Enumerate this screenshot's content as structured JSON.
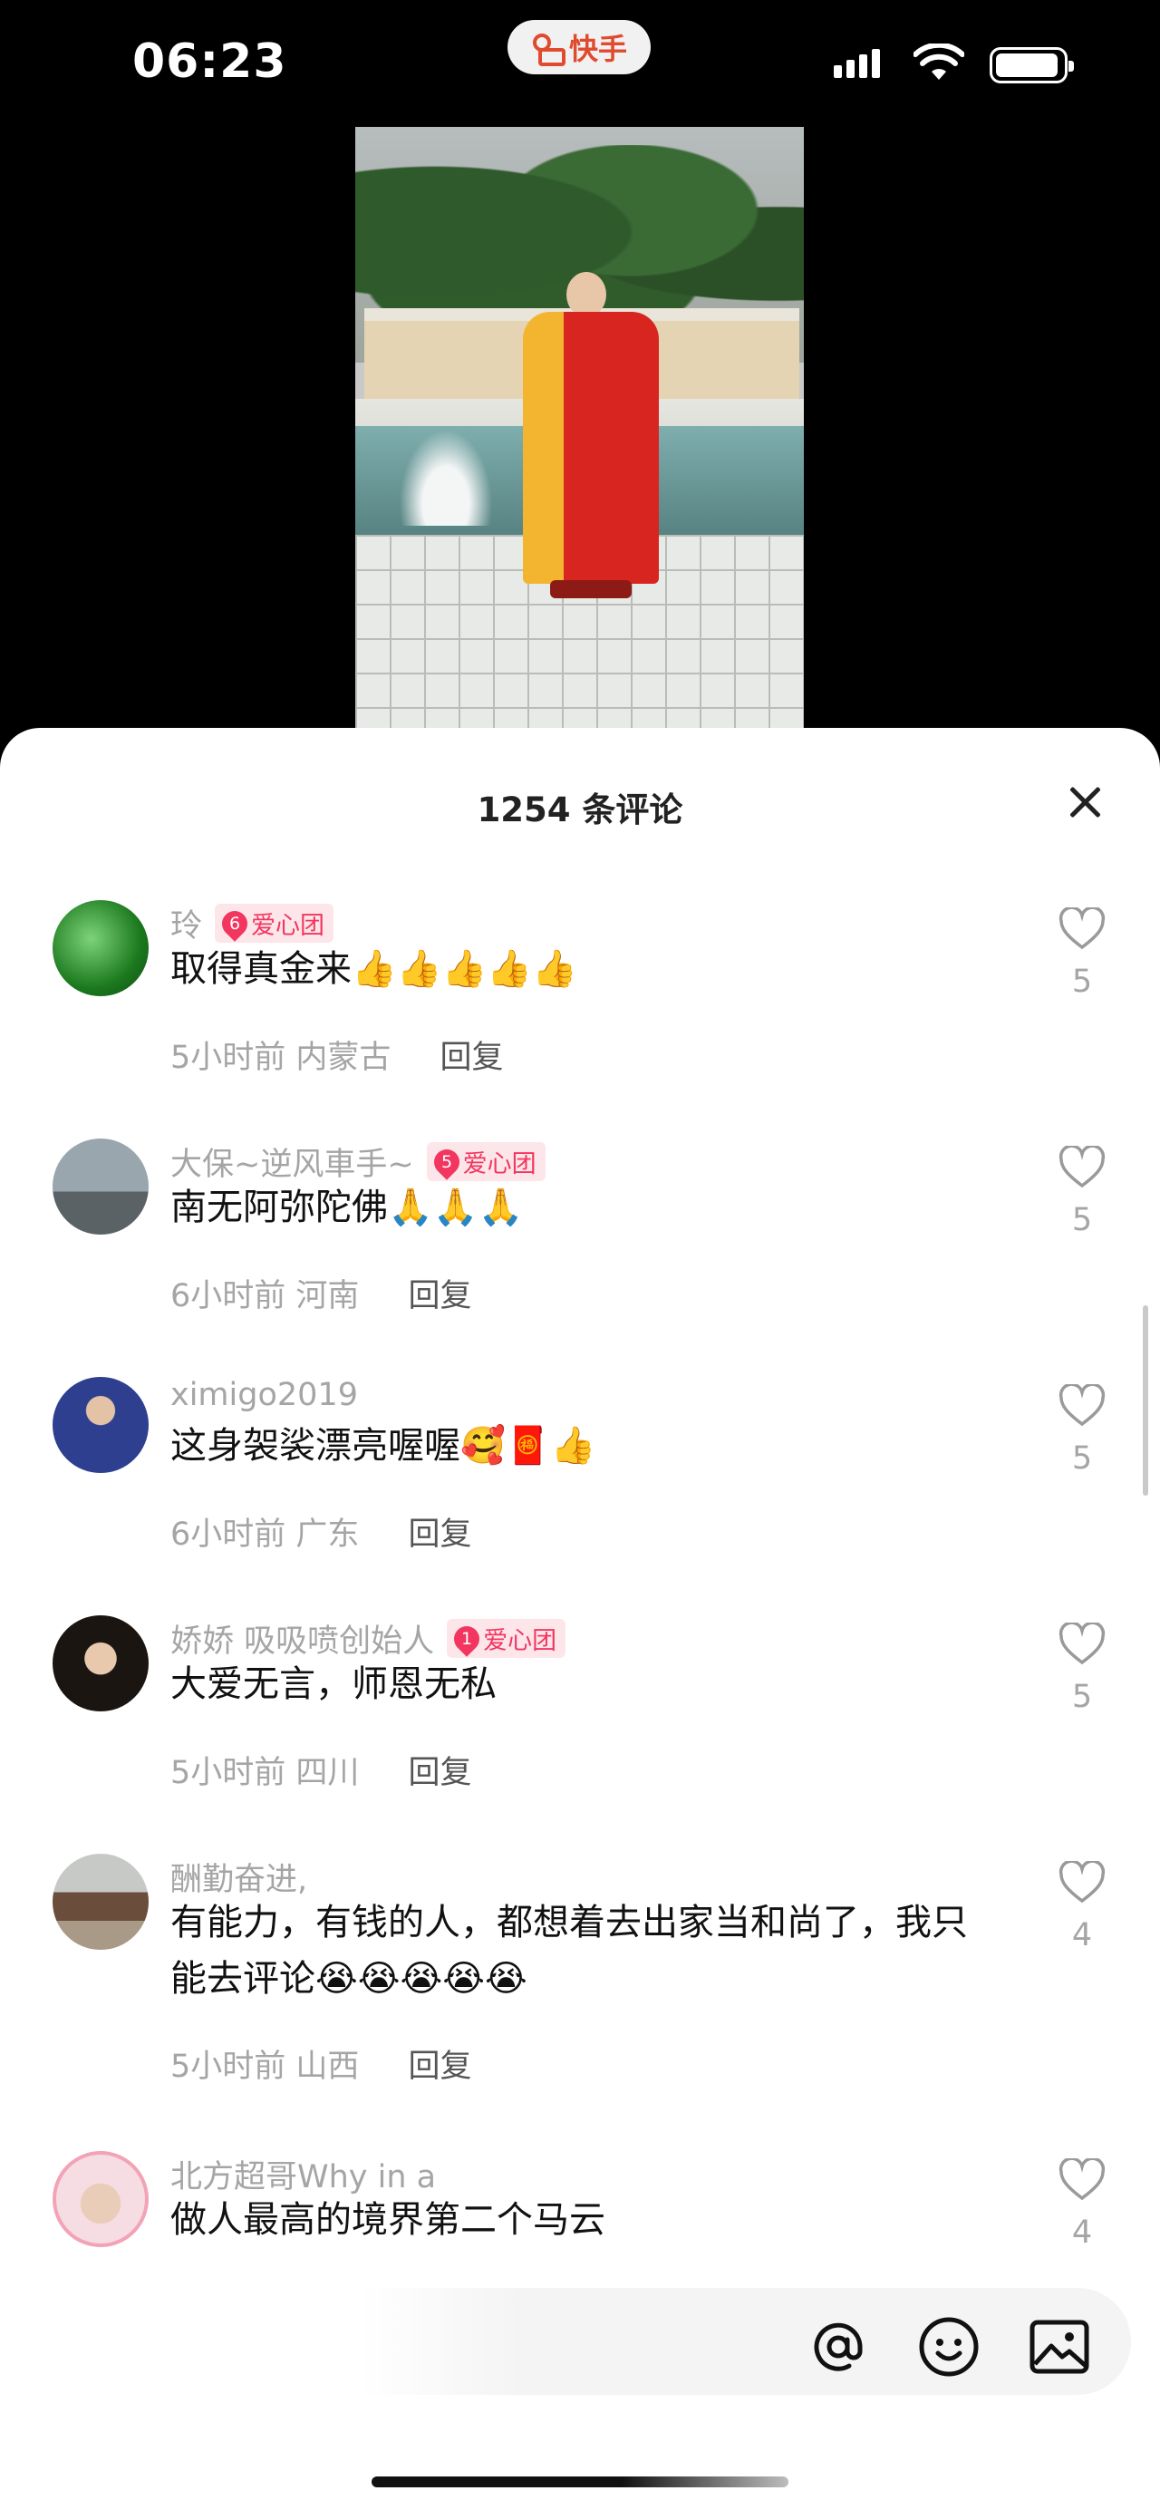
{
  "status": {
    "time": "06:23",
    "app_name": "快手"
  },
  "sheet": {
    "title": "1254 条评论"
  },
  "comments": [
    {
      "user": "玲",
      "badge_level": "6",
      "badge_text": "爱心团",
      "text": "取得真金来👍👍👍👍👍",
      "time": "5小时前",
      "location": "内蒙古",
      "reply": "回复",
      "likes": "5"
    },
    {
      "user": "大保~逆风車手~",
      "badge_level": "5",
      "badge_text": "爱心团",
      "text": "南无阿弥陀佛🙏🙏🙏",
      "time": "6小时前",
      "location": "河南",
      "reply": "回复",
      "likes": "5"
    },
    {
      "user": "ximigo2019",
      "badge_level": "",
      "badge_text": "",
      "text": "这身袈裟漂亮喔喔🥰🧧👍",
      "time": "6小时前",
      "location": "广东",
      "reply": "回复",
      "likes": "5"
    },
    {
      "user": "娇娇 吸吸喷创始人",
      "badge_level": "1",
      "badge_text": "爱心团",
      "text": "大爱无言，师恩无私",
      "time": "5小时前",
      "location": "四川",
      "reply": "回复",
      "likes": "5"
    },
    {
      "user": "酬勤奋进,",
      "badge_level": "",
      "badge_text": "",
      "text": "有能力，有钱的人，都想着去出家当和尚了，我只能去评论😭😭😭😭😭",
      "time": "5小时前",
      "location": "山西",
      "reply": "回复",
      "likes": "4"
    },
    {
      "user": "北方超哥Why in a",
      "badge_level": "",
      "badge_text": "",
      "text": "做人最高的境界第二个马云",
      "time": "",
      "location": "",
      "reply": "",
      "likes": "4"
    }
  ],
  "input": {
    "icons": [
      "at-icon",
      "emoji-icon",
      "image-icon"
    ]
  },
  "colors": {
    "badge_pink": "#f2365f",
    "brand_orange": "#e04a2f",
    "meta_gray": "#a5a5a5"
  }
}
